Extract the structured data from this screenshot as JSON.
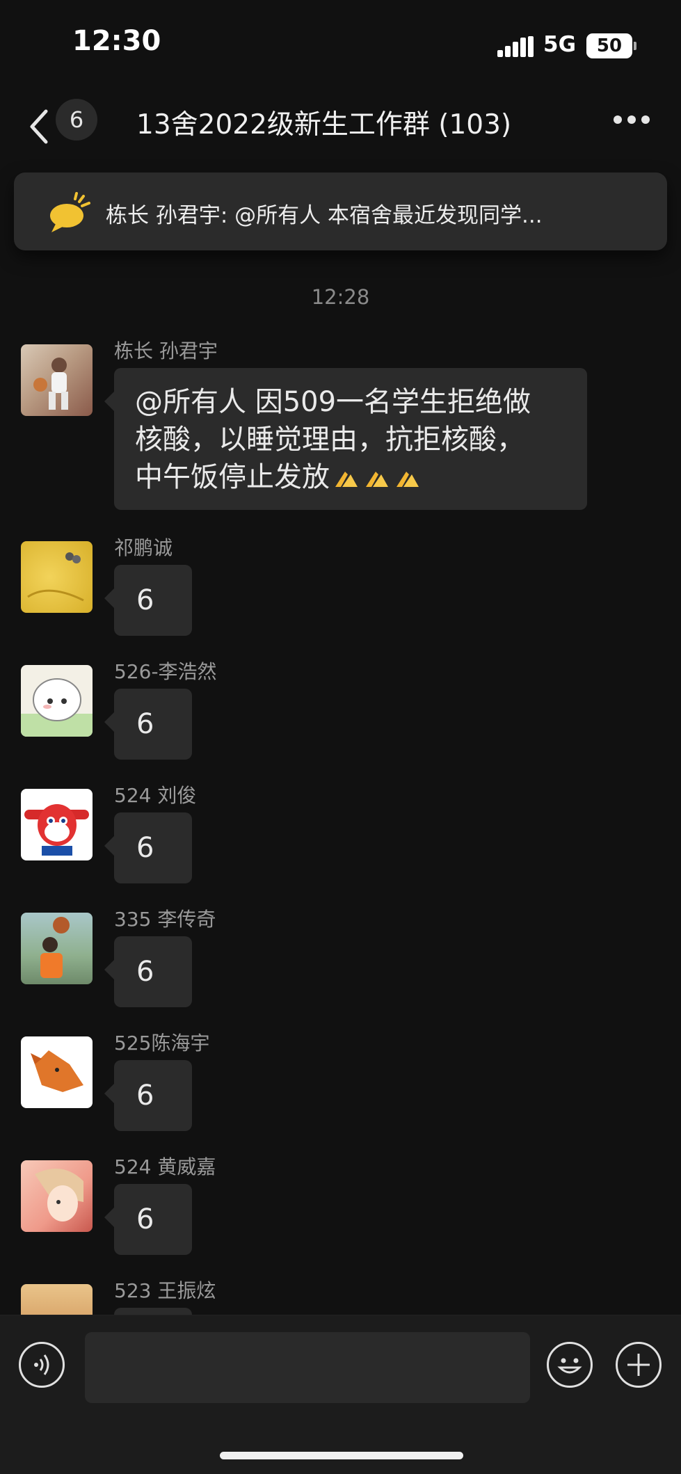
{
  "status_bar": {
    "time": "12:30",
    "network": "5G",
    "battery": "50"
  },
  "nav": {
    "unread_count": "6",
    "title": "13舍2022级新生工作群 (103)"
  },
  "notice": {
    "text": "栋长 孙君宇: @所有人 本宿舍最近发现同学..."
  },
  "chat": {
    "timestamp": "12:28",
    "messages": [
      {
        "sender": "栋长 孙君宇",
        "lines": [
          "@所有人 因509一名学生拒绝做",
          "核酸，以睡觉理由，抗拒核酸，",
          "中午饭停止发放"
        ],
        "emoji": "folded-hands"
      },
      {
        "sender": "祁鹏诚",
        "text": "6"
      },
      {
        "sender": "526-李浩然",
        "text": "6"
      },
      {
        "sender": "524 刘俊",
        "text": "6"
      },
      {
        "sender": "335 李传奇",
        "text": "6"
      },
      {
        "sender": "525陈海宇",
        "text": "6"
      },
      {
        "sender": "524 黄威嘉",
        "text": "6"
      },
      {
        "sender": "523 王振炫",
        "text": ""
      }
    ]
  },
  "icons": {
    "back": "chevron-left-icon",
    "more": "more-dots-icon",
    "notice": "megaphone-icon",
    "voice": "voice-icon",
    "emoji": "emoji-icon",
    "plus": "plus-icon"
  },
  "colors": {
    "background": "#111111",
    "bubble": "#2b2b2b",
    "notice_icon": "#f1c232",
    "text": "#eaeaea",
    "secondary_text": "#9a9a9a"
  }
}
